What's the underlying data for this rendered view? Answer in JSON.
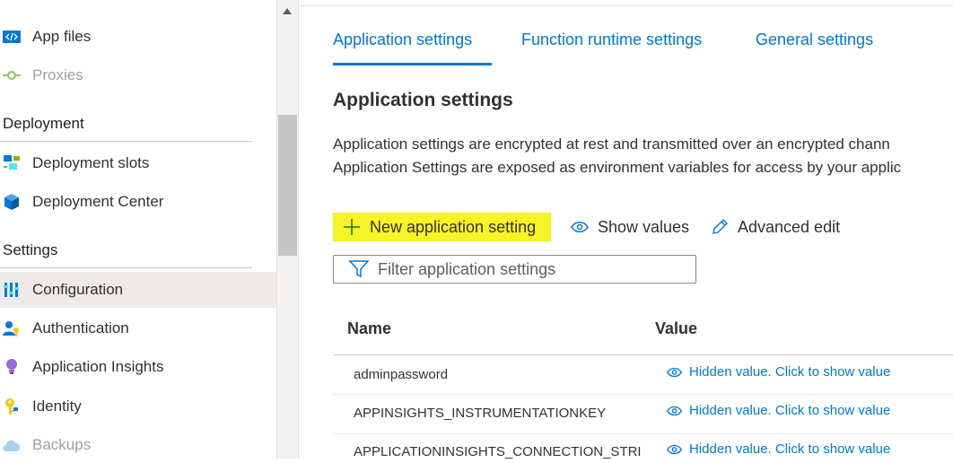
{
  "sidebar": {
    "items_top": [
      {
        "label": "App files",
        "icon": "code-file-icon"
      },
      {
        "label": "Proxies",
        "icon": "proxy-icon",
        "disabled": true
      }
    ],
    "sections": [
      {
        "title": "Deployment",
        "items": [
          {
            "label": "Deployment slots",
            "icon": "deployment-slots-icon"
          },
          {
            "label": "Deployment Center",
            "icon": "cube-icon"
          }
        ]
      },
      {
        "title": "Settings",
        "items": [
          {
            "label": "Configuration",
            "icon": "configuration-sliders-icon",
            "selected": true
          },
          {
            "label": "Authentication",
            "icon": "user-key-icon"
          },
          {
            "label": "Application Insights",
            "icon": "lightbulb-icon"
          },
          {
            "label": "Identity",
            "icon": "key-icon"
          },
          {
            "label": "Backups",
            "icon": "cloud-icon",
            "disabled": true
          }
        ]
      }
    ]
  },
  "tabs": [
    {
      "label": "Application settings",
      "active": true
    },
    {
      "label": "Function runtime settings"
    },
    {
      "label": "General settings"
    }
  ],
  "section_title": "Application settings",
  "description": [
    "Application settings are encrypted at rest and transmitted over an encrypted chann",
    "Application Settings are exposed as environment variables for access by your applic"
  ],
  "commands": {
    "new": "New application setting",
    "show": "Show values",
    "advanced": "Advanced edit"
  },
  "filter": {
    "placeholder": "Filter application settings"
  },
  "table": {
    "headers": [
      "Name",
      "Value"
    ],
    "rows": [
      {
        "name": "adminpassword",
        "value": "Hidden value. Click to show value"
      },
      {
        "name": "APPINSIGHTS_INSTRUMENTATIONKEY",
        "value": "Hidden value. Click to show value"
      },
      {
        "name": "APPLICATIONINSIGHTS_CONNECTION_STRING",
        "value": "Hidden value. Click to show value"
      }
    ]
  },
  "colors": {
    "accent": "#0078d4",
    "highlight": "#f6f327",
    "selected_bg": "#edebe9"
  }
}
